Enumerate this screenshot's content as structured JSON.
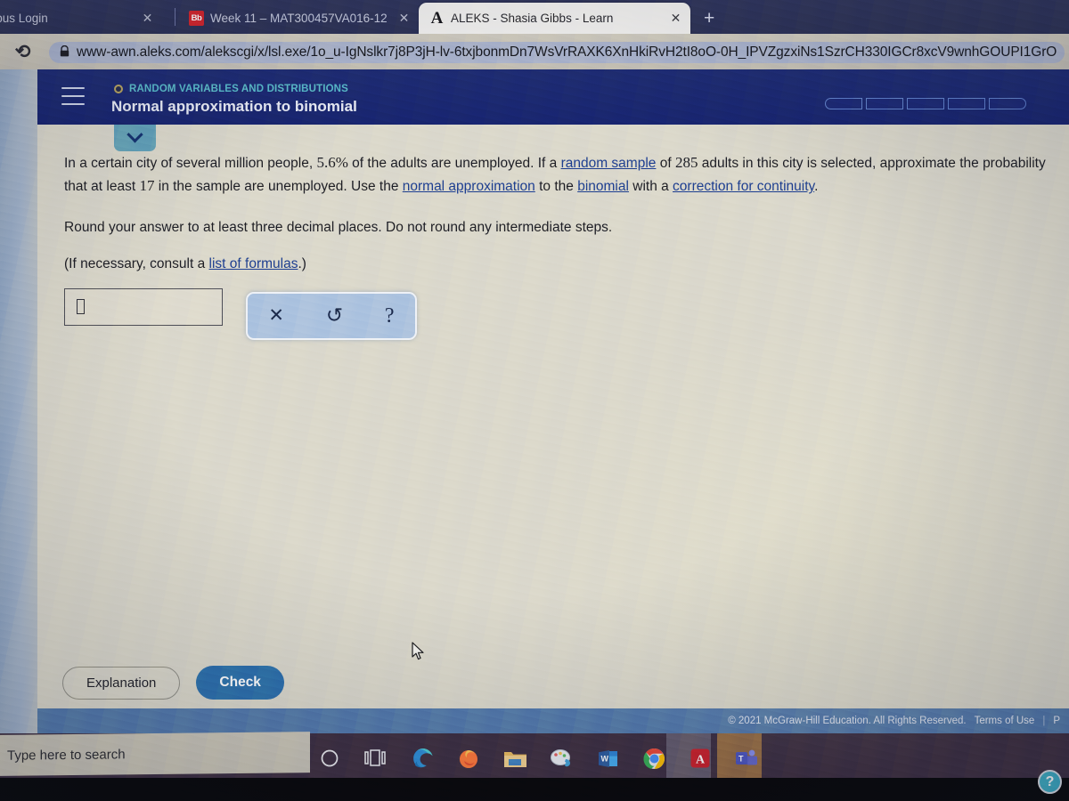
{
  "browser": {
    "tabs": [
      {
        "title": "mpus Login",
        "favicon": "generic-icon",
        "active": false,
        "close": "✕"
      },
      {
        "title": "Week 11 – MAT300457VA016-12",
        "favicon": "blackboard-icon",
        "active": false,
        "close": "✕"
      },
      {
        "title": "ALEKS - Shasia Gibbs - Learn",
        "favicon": "aleks-icon",
        "active": true,
        "close": "✕"
      }
    ],
    "new_tab_label": "+",
    "reload_icon": "⟳",
    "lock_icon": "🔒",
    "url": "www-awn.aleks.com/alekscgi/x/lsl.exe/1o_u-IgNslkr7j8P3jH-lv-6txjbonmDn7WsVrRAXK6XnHkiRvH2tI8oO-0H_IPVZgzxiNs1SzrCH330IGCr8xcV9wnhGOUPI1GrO"
  },
  "aleks": {
    "menu_icon": "hamburger-icon",
    "eyebrow": "RANDOM VARIABLES AND DISTRIBUTIONS",
    "title": "Normal approximation to binomial",
    "progress_segments": 5,
    "drawer_icon": "chevron-down-icon",
    "question": {
      "line1_a": "In a certain city of several million people, ",
      "pct": "5.6%",
      "line1_b": " of the adults are unemployed. If a ",
      "link_random_sample": "random sample",
      "line1_c": " of ",
      "sample_n": "285",
      "line1_d": " adults in this city is selected, approximate the probability that at least ",
      "at_least_k": "17",
      "line1_e": " in the sample are unemployed. Use the ",
      "link_normal_approximation": "normal approximation",
      "line1_f": " to the ",
      "link_binomial": "binomial",
      "line1_g": " with a ",
      "link_correction": "correction for continuity",
      "line1_h": ".",
      "line2": "Round your answer to at least three decimal places. Do not round any intermediate steps.",
      "line3_a": "(If necessary, consult a ",
      "link_formulas": "list of formulas",
      "line3_b": ".)"
    },
    "answer_value": "",
    "tools": [
      {
        "name": "clear-button",
        "glyph": "✕"
      },
      {
        "name": "undo-button",
        "glyph": "↺"
      },
      {
        "name": "help-button",
        "glyph": "?"
      }
    ],
    "explanation_label": "Explanation",
    "check_label": "Check",
    "copyright": "© 2021 McGraw-Hill Education. All Rights Reserved.",
    "terms_label": "Terms of Use",
    "separator": "|",
    "privacy_label": "P"
  },
  "taskbar": {
    "search_placeholder": "Type here to search",
    "icons": [
      "cortana-icon",
      "task-view-icon",
      "edge-icon",
      "firefox-icon",
      "file-explorer-icon",
      "paint-icon",
      "word-icon",
      "chrome-icon",
      "acrobat-icon",
      "teams-icon"
    ],
    "help_fab": "?"
  },
  "colors": {
    "aleks_header": "#17236a",
    "check_button": "#2b6ba8",
    "link": "#1b3a8a",
    "eyebrow": "#56b8c8",
    "page_bg": "#d9d6c9",
    "footer_bar": "#5175a8"
  }
}
